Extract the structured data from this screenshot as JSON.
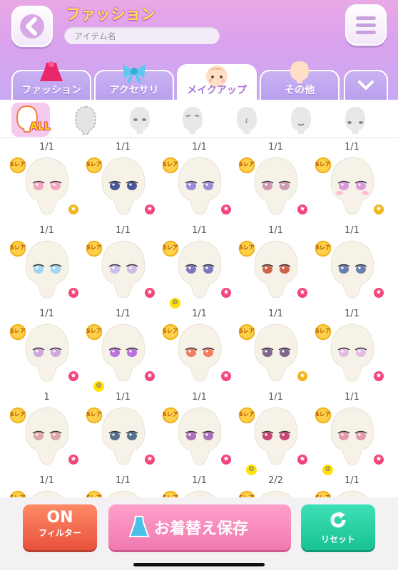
{
  "header": {
    "title": "ファッション",
    "search_placeholder": "アイテム名"
  },
  "tabs": [
    {
      "label": "ファッション",
      "icon": "dress-icon"
    },
    {
      "label": "アクセサリ",
      "icon": "ribbon-icon"
    },
    {
      "label": "メイクアップ",
      "icon": "face-icon",
      "active": true
    },
    {
      "label": "その他",
      "icon": "head-icon"
    }
  ],
  "filters": {
    "all_label": "ALL",
    "items": [
      "all-filter",
      "face-outline-filter",
      "eyes-filter",
      "eyebrows-filter",
      "nose-filter",
      "mouth-filter",
      "cheeks-filter"
    ]
  },
  "items": [
    {
      "count": "1/1",
      "eye": "#f29ab8",
      "badge": "gold"
    },
    {
      "count": "1/1",
      "eye": "#2c3d8c",
      "badge": "pink"
    },
    {
      "count": "1/1",
      "eye": "#8a7bd6",
      "badge": "pink"
    },
    {
      "count": "1/1",
      "eye": "#c78aa8",
      "badge": "pink"
    },
    {
      "count": "1/1",
      "eye": "#d58ad8",
      "badge": "gold",
      "blush": true
    },
    {
      "count": "1/1",
      "eye": "#8fd3ee",
      "badge": "pink"
    },
    {
      "count": "1/1",
      "eye": "#c7b4e8",
      "badge": "pink"
    },
    {
      "count": "1/1",
      "eye": "#6a63b8",
      "badge": "pink",
      "bulb": true
    },
    {
      "count": "1/1",
      "eye": "#c84a2e",
      "badge": "pink"
    },
    {
      "count": "1/1",
      "eye": "#4d6ca8",
      "badge": "pink"
    },
    {
      "count": "1/1",
      "eye": "#c89ad8",
      "badge": "pink"
    },
    {
      "count": "1/1",
      "eye": "#b05ad8",
      "badge": "pink",
      "bulb": true
    },
    {
      "count": "1/1",
      "eye": "#f0684a",
      "badge": "pink"
    },
    {
      "count": "1/1",
      "eye": "#6a4a80",
      "badge": "gold"
    },
    {
      "count": "1/1",
      "eye": "#e0b2e0",
      "badge": "pink"
    },
    {
      "count": "1",
      "eye": "#d89a9a",
      "badge": "pink"
    },
    {
      "count": "1/1",
      "eye": "#3a5a7a",
      "badge": "pink"
    },
    {
      "count": "1/1",
      "eye": "#9a5ab0",
      "badge": "pink"
    },
    {
      "count": "1/1",
      "eye": "#c02860",
      "badge": "pink",
      "bulb": true
    },
    {
      "count": "1/1",
      "eye": "#e08aa0",
      "badge": "pink",
      "bulb": true
    },
    {
      "count": "1/1",
      "eye": "#999",
      "badge": "none"
    },
    {
      "count": "1/1",
      "eye": "#999",
      "badge": "none"
    },
    {
      "count": "1/1",
      "eye": "#999",
      "badge": "none"
    },
    {
      "count": "2/2",
      "eye": "#999",
      "badge": "none"
    },
    {
      "count": "1/1",
      "eye": "#999",
      "badge": "none"
    }
  ],
  "rare_label": "Sレア",
  "buttons": {
    "filter_on": "ON",
    "filter_label": "フィルター",
    "save": "お着替え保存",
    "reset": "リセット"
  }
}
